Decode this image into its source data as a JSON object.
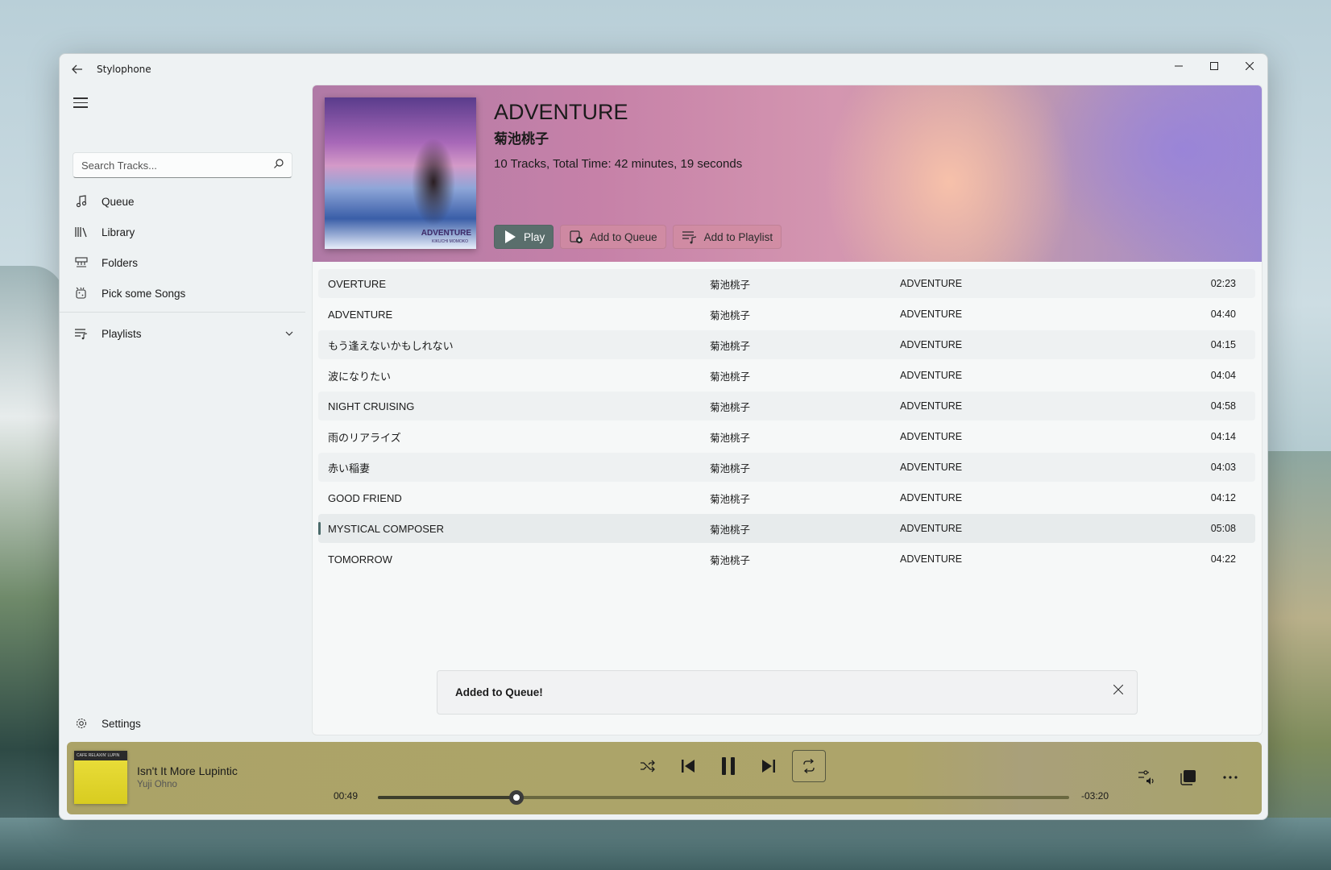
{
  "app": {
    "title": "Stylophone",
    "back_icon": "back-arrow-icon"
  },
  "sidebar": {
    "search_placeholder": "Search Tracks...",
    "items": [
      {
        "label": "Queue",
        "icon": "music-note-icon"
      },
      {
        "label": "Library",
        "icon": "library-icon"
      },
      {
        "label": "Folders",
        "icon": "folders-icon"
      },
      {
        "label": "Pick some Songs",
        "icon": "dice-icon"
      }
    ],
    "playlists_label": "Playlists",
    "settings_label": "Settings"
  },
  "album": {
    "title": "ADVENTURE",
    "artist": "菊池桃子",
    "meta": "10 Tracks, Total Time: 42 minutes, 19 seconds",
    "cover_text": "ADVENTURE",
    "cover_sub": "KIKUCHI MOMOKO",
    "actions": {
      "play": "Play",
      "add_queue": "Add to Queue",
      "add_playlist": "Add to Playlist"
    }
  },
  "tracks": [
    {
      "title": "OVERTURE",
      "artist": "菊池桃子",
      "album": "ADVENTURE",
      "time": "02:23"
    },
    {
      "title": "ADVENTURE",
      "artist": "菊池桃子",
      "album": "ADVENTURE",
      "time": "04:40"
    },
    {
      "title": "もう逢えないかもしれない",
      "artist": "菊池桃子",
      "album": "ADVENTURE",
      "time": "04:15"
    },
    {
      "title": "波になりたい",
      "artist": "菊池桃子",
      "album": "ADVENTURE",
      "time": "04:04"
    },
    {
      "title": "NIGHT CRUISING",
      "artist": "菊池桃子",
      "album": "ADVENTURE",
      "time": "04:58"
    },
    {
      "title": "雨のリアライズ",
      "artist": "菊池桃子",
      "album": "ADVENTURE",
      "time": "04:14"
    },
    {
      "title": "赤い稲妻",
      "artist": "菊池桃子",
      "album": "ADVENTURE",
      "time": "04:03"
    },
    {
      "title": "GOOD FRIEND",
      "artist": "菊池桃子",
      "album": "ADVENTURE",
      "time": "04:12"
    },
    {
      "title": "MYSTICAL COMPOSER",
      "artist": "菊池桃子",
      "album": "ADVENTURE",
      "time": "05:08"
    },
    {
      "title": "TOMORROW",
      "artist": "菊池桃子",
      "album": "ADVENTURE",
      "time": "04:22"
    }
  ],
  "selected_track_index": 8,
  "toast": {
    "message": "Added to Queue!"
  },
  "player": {
    "title": "Isn't It More Lupintic",
    "artist": "Yuji Ohno",
    "cover_text": "CAFE RELAXIN' LUPIN",
    "time_current": "00:49",
    "time_remaining": "-03:20",
    "progress_fraction": 0.2,
    "colors": {
      "accent": "#ada46a"
    }
  }
}
